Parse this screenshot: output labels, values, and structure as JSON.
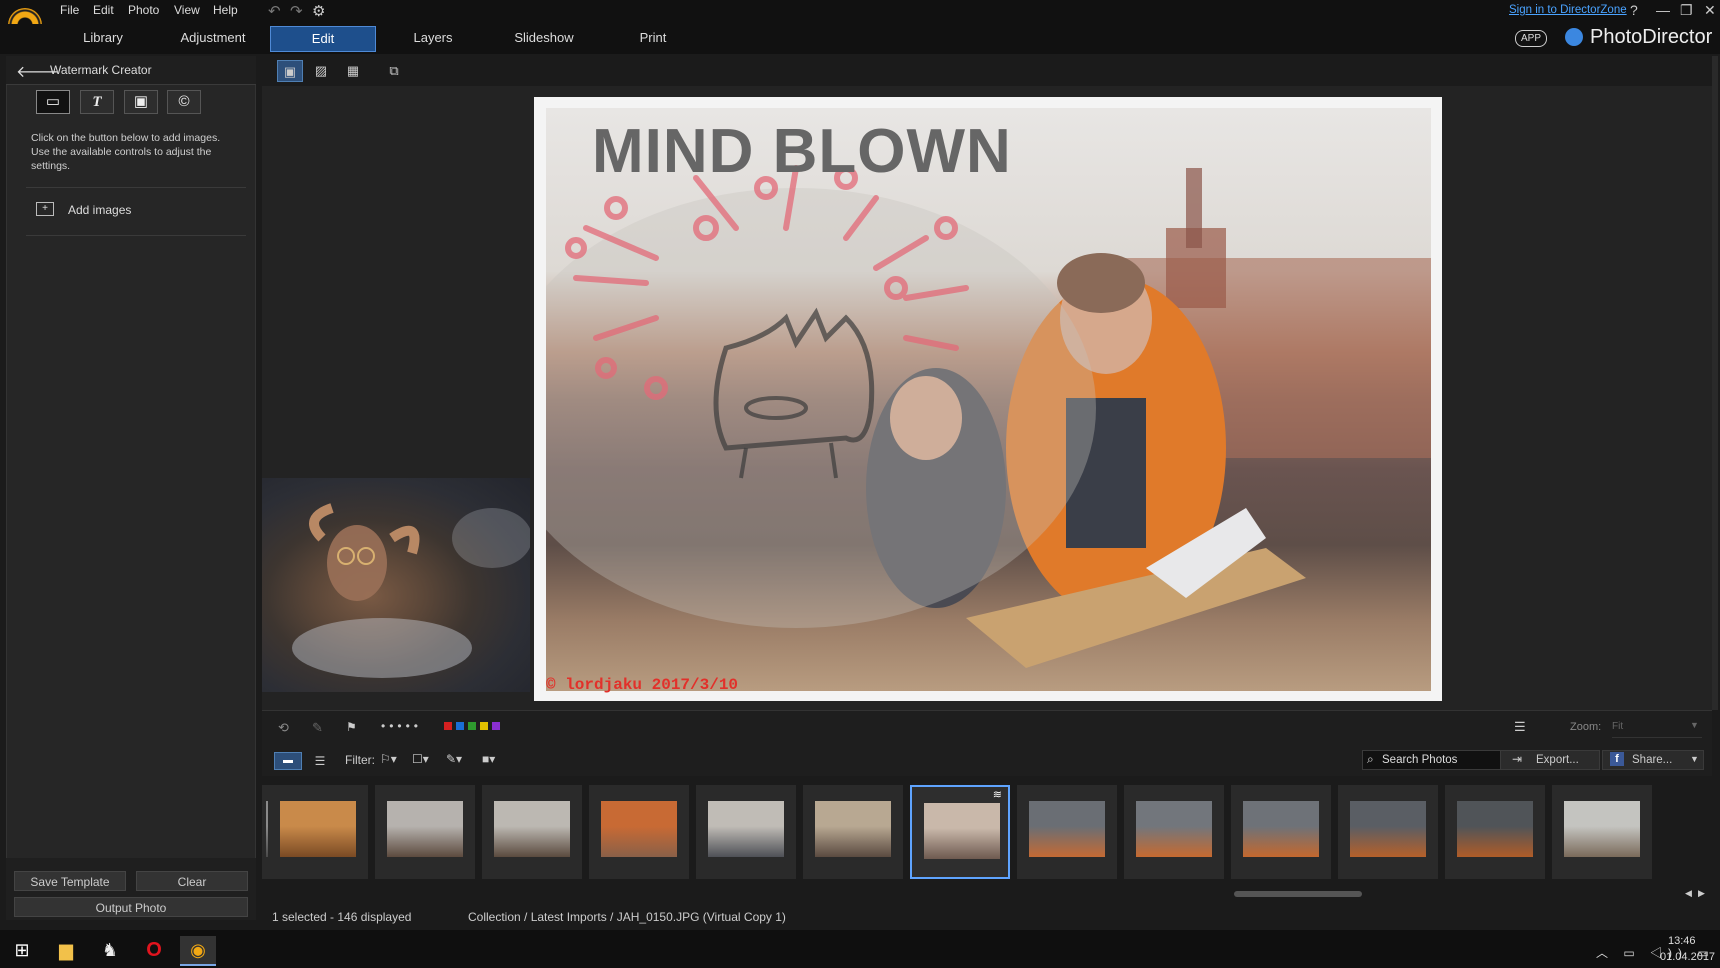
{
  "menu": [
    "File",
    "Edit",
    "Photo",
    "View",
    "Help"
  ],
  "signin": "Sign in to DirectorZone",
  "tabs": [
    "Library",
    "Adjustment",
    "Edit",
    "Layers",
    "Slideshow",
    "Print"
  ],
  "active_tab": "Edit",
  "app_badge": "APP",
  "app_title": "PhotoDirector",
  "left_panel": {
    "title": "Watermark Creator",
    "type_buttons": [
      "rectangle-icon",
      "text-icon",
      "image-icon",
      "copyright-icon"
    ],
    "type_glyphs": [
      "▭",
      "T",
      "🖼",
      "©"
    ],
    "hint": "Click on the button below to add images. Use the available controls to adjust the settings.",
    "add_images": "Add images",
    "save_template": "Save Template",
    "clear": "Clear",
    "output_photo": "Output Photo"
  },
  "photo": {
    "watermark_title": "MIND BLOWN",
    "signature": "© lordjaku  2017/3/10"
  },
  "toolbar": {
    "zoom_label": "Zoom:",
    "zoom_value": "Fit",
    "filter_label": "Filter:",
    "search_placeholder": "Search Photos",
    "export": "Export...",
    "share": "Share...",
    "label_colors": [
      "#d42020",
      "#1a6fd6",
      "#2e9a2e",
      "#e0c000",
      "#8a2fd0"
    ]
  },
  "filmstrip": {
    "thumbs": [
      {
        "name": "partial",
        "colors": [
          "#8a8a8a",
          "#4a4a4a"
        ]
      },
      {
        "name": "pizza",
        "colors": [
          "#c98a4a",
          "#7a4a24"
        ]
      },
      {
        "name": "river-city-1",
        "colors": [
          "#b6b2ae",
          "#5c4a3e"
        ]
      },
      {
        "name": "river-city-2",
        "colors": [
          "#bcb8b2",
          "#5a4a3e"
        ]
      },
      {
        "name": "building-orange",
        "colors": [
          "#c86a34",
          "#8a6048"
        ]
      },
      {
        "name": "river-city-3",
        "colors": [
          "#c0bcb6",
          "#4e5056"
        ]
      },
      {
        "name": "people-eating",
        "colors": [
          "#b8a892",
          "#5a4a40"
        ]
      },
      {
        "name": "selected-blur",
        "colors": [
          "#c9b8aa",
          "#6e5a50"
        ]
      },
      {
        "name": "bridge-1",
        "colors": [
          "#6a6e74",
          "#c46a34"
        ]
      },
      {
        "name": "bridge-2",
        "colors": [
          "#72767c",
          "#c66a30"
        ]
      },
      {
        "name": "bridge-3",
        "colors": [
          "#6e7278",
          "#c4682e"
        ]
      },
      {
        "name": "bridge-4",
        "colors": [
          "#5a5e64",
          "#b6602a"
        ]
      },
      {
        "name": "bridge-5",
        "colors": [
          "#505458",
          "#b05c28"
        ]
      },
      {
        "name": "river-boat",
        "colors": [
          "#c4c4c0",
          "#7a6a5a"
        ]
      }
    ],
    "selected_index": 7
  },
  "status": {
    "selected": "1 selected - 146 displayed",
    "path": "Collection / Latest Imports / JAH_0150.JPG (Virtual Copy 1)"
  },
  "clock": {
    "time": "13:46",
    "date": "01.04.2017"
  }
}
